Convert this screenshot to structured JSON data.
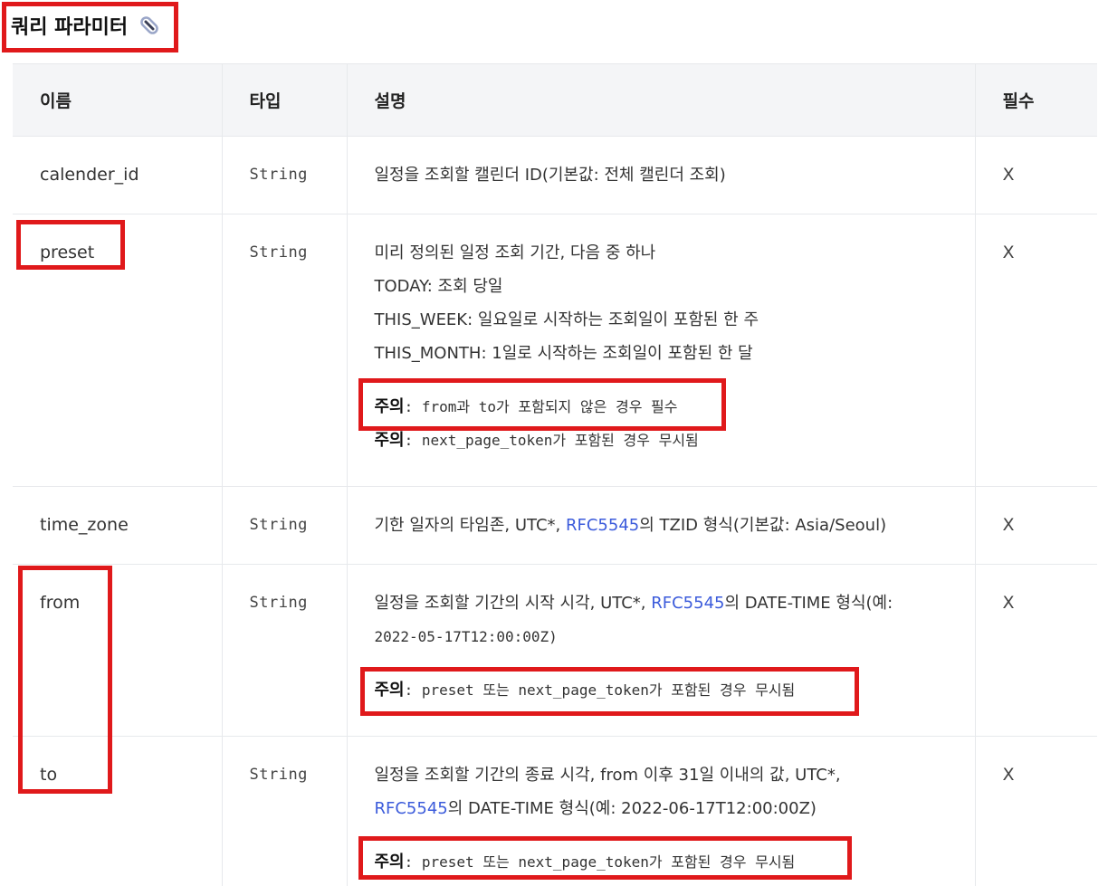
{
  "heading": {
    "title": "쿼리 파라미터",
    "icon": "link-icon"
  },
  "columns": {
    "name": "이름",
    "type": "타입",
    "desc": "설명",
    "required": "필수"
  },
  "rows": [
    {
      "name": "calender_id",
      "type": "String",
      "desc": "일정을 조회할 캘린더 ID(기본값: 전체 캘린더 조회)",
      "required": "X"
    },
    {
      "name": "preset",
      "type": "String",
      "lines": [
        "미리 정의된 일정 조회 기간, 다음 중 하나",
        "TODAY: 조회 당일",
        "THIS_WEEK: 일요일로 시작하는 조회일이 포함된 한 주",
        "THIS_MONTH: 1일로 시작하는 조회일이 포함된 한 달"
      ],
      "note_label": "주의",
      "note1": ": from과 to가 포함되지 않은 경우 필수",
      "note2": ": next_page_token가 포함된 경우 무시됨",
      "required": "X"
    },
    {
      "name": "time_zone",
      "type": "String",
      "desc_a": "기한 일자의 타임존, UTC*, ",
      "link": "RFC5545",
      "desc_b": "의 TZID 형식(기본값: Asia/Seoul)",
      "required": "X"
    },
    {
      "name": "from",
      "type": "String",
      "desc_a": "일정을 조회할 기간의 시작 시각, UTC*, ",
      "link": "RFC5545",
      "desc_b": "의 DATE-TIME 형식(예:",
      "desc_c": "2022-05-17T12:00:00Z)",
      "note_label": "주의",
      "note": ": preset 또는 next_page_token가 포함된 경우 무시됨",
      "required": "X"
    },
    {
      "name": "to",
      "type": "String",
      "desc_a": "일정을 조회할 기간의 종료 시각, from 이후 31일 이내의 값, UTC*,",
      "link": "RFC5545",
      "desc_b": "의 DATE-TIME 형식(예: 2022-06-17T12:00:00Z)",
      "note_label": "주의",
      "note": ": preset 또는 next_page_token가 포함된 경우 무시됨",
      "required": "X"
    }
  ]
}
